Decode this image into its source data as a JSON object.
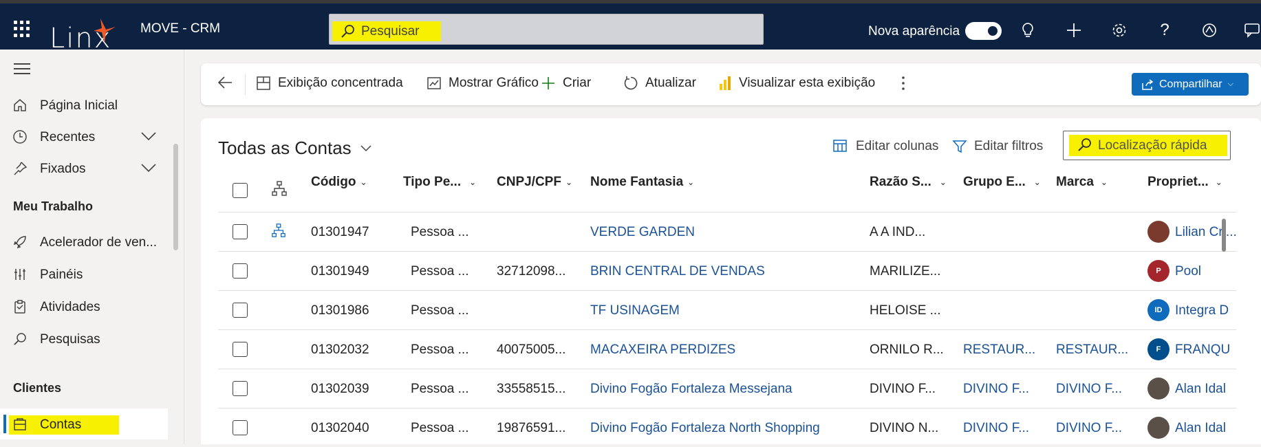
{
  "app": {
    "name": "MOVE - CRM",
    "logo_text": "Linx"
  },
  "search": {
    "placeholder": "Pesquisar"
  },
  "topbar": {
    "new_look_label": "Nova aparência",
    "new_look_on": true
  },
  "sidebar": {
    "items": [
      {
        "label": "Página Inicial",
        "icon": "home-icon"
      },
      {
        "label": "Recentes",
        "icon": "clock-icon",
        "expandable": true
      },
      {
        "label": "Fixados",
        "icon": "pin-icon",
        "expandable": true
      }
    ],
    "section_my_work": "Meu Trabalho",
    "work_items": [
      {
        "label": "Acelerador de ven...",
        "icon": "rocket-icon"
      },
      {
        "label": "Painéis",
        "icon": "dashboard-icon"
      },
      {
        "label": "Atividades",
        "icon": "clipboard-icon"
      },
      {
        "label": "Pesquisas",
        "icon": "search-icon"
      }
    ],
    "section_clients": "Clientes",
    "client_items": [
      {
        "label": "Contas",
        "icon": "accounts-icon",
        "selected": true
      }
    ]
  },
  "commandbar": {
    "concentrated": "Exibição concentrada",
    "show_chart": "Mostrar Gráfico",
    "create": "Criar",
    "refresh": "Atualizar",
    "visualize": "Visualizar esta exibição",
    "share": "Compartilhar"
  },
  "view": {
    "title": "Todas as Contas",
    "edit_columns": "Editar colunas",
    "edit_filters": "Editar filtros",
    "quick_find": "Localização rápida"
  },
  "columns": [
    "Código",
    "Tipo Pe...",
    "CNPJ/CPF",
    "Nome Fantasia",
    "Razão S...",
    "Grupo E...",
    "Marca",
    "Propriet..."
  ],
  "rows": [
    {
      "codigo": "01301947",
      "tipo": "Pessoa ...",
      "cnpj": "",
      "nome": "VERDE GARDEN",
      "razao": "A  A IND...",
      "grupo": "",
      "marca": "",
      "owner": "Lilian Cri...",
      "avatar": "photo",
      "avatar_color": "#7a3b2e",
      "hierarchy": true
    },
    {
      "codigo": "01301949",
      "tipo": "Pessoa ...",
      "cnpj": "32712098...",
      "nome": "BRIN CENTRAL DE VENDAS",
      "razao": "MARILIZE...",
      "grupo": "",
      "marca": "",
      "owner": "Pool",
      "avatar": "P",
      "avatar_color": "#a4262c",
      "hierarchy": false
    },
    {
      "codigo": "01301986",
      "tipo": "Pessoa ...",
      "cnpj": "",
      "nome": "TF USINAGEM",
      "razao": "HELOISE ...",
      "grupo": "",
      "marca": "",
      "owner": "Integra D",
      "avatar": "ID",
      "avatar_color": "#0f6cbd",
      "hierarchy": false
    },
    {
      "codigo": "01302032",
      "tipo": "Pessoa ...",
      "cnpj": "40075005...",
      "nome": "MACAXEIRA PERDIZES",
      "razao": "ORNILO R...",
      "grupo": "RESTAUR...",
      "marca": "RESTAUR...",
      "owner": "FRANQU",
      "avatar": "F",
      "avatar_color": "#004e8c",
      "hierarchy": false
    },
    {
      "codigo": "01302039",
      "tipo": "Pessoa ...",
      "cnpj": "33558515...",
      "nome": "Divino Fogão Fortaleza Messejana",
      "razao": "DIVINO F...",
      "grupo": "DIVINO F...",
      "marca": "DIVINO F...",
      "owner": "Alan Idal",
      "avatar": "photo",
      "avatar_color": "#5a5048",
      "hierarchy": false
    },
    {
      "codigo": "01302040",
      "tipo": "Pessoa ...",
      "cnpj": "19876591...",
      "nome": "Divino Fogão Fortaleza North Shopping",
      "razao": "DIVINO N...",
      "grupo": "DIVINO F...",
      "marca": "DIVINO F...",
      "owner": "Alan Idal",
      "avatar": "photo",
      "avatar_color": "#5a5048",
      "hierarchy": false
    }
  ]
}
